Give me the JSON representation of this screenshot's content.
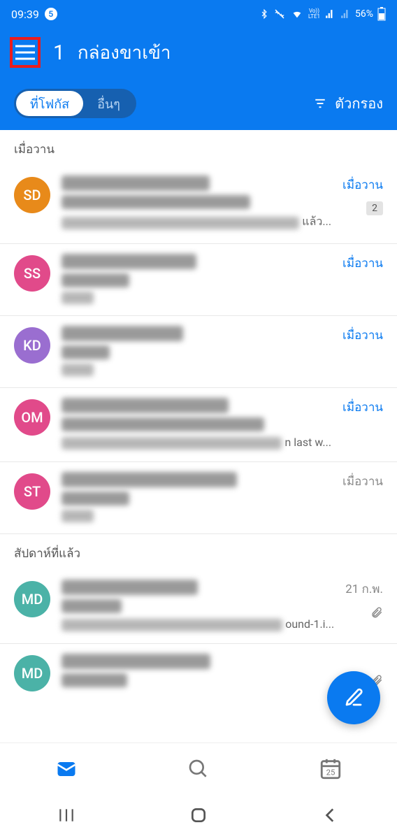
{
  "status": {
    "time": "09:39",
    "notif_count": "5",
    "battery": "56%"
  },
  "header": {
    "highlight_number": "1",
    "title": "กล่องขาเข้า"
  },
  "tabs": {
    "focused": "ที่โฟกัส",
    "other": "อื่นๆ",
    "filter": "ตัวกรอง"
  },
  "sections": {
    "yesterday": "เมื่อวาน",
    "last_week": "สัปดาห์ที่แล้ว"
  },
  "emails": [
    {
      "initials": "SD",
      "color": "c-orange",
      "time": "เมื่อวาน",
      "time_muted": false,
      "count": "2",
      "suffix": "แล้ว...",
      "attach": false
    },
    {
      "initials": "SS",
      "color": "c-pink",
      "time": "เมื่อวาน",
      "time_muted": false,
      "count": "",
      "suffix": "",
      "attach": false
    },
    {
      "initials": "KD",
      "color": "c-purple",
      "time": "เมื่อวาน",
      "time_muted": false,
      "count": "",
      "suffix": "",
      "attach": false
    },
    {
      "initials": "OM",
      "color": "c-pink",
      "time": "เมื่อวาน",
      "time_muted": false,
      "count": "",
      "suffix": "n last w...",
      "attach": false
    },
    {
      "initials": "ST",
      "color": "c-pink",
      "time": "เมื่อวาน",
      "time_muted": true,
      "count": "",
      "suffix": "",
      "attach": false
    },
    {
      "initials": "MD",
      "color": "c-teal",
      "time": "21 ก.พ.",
      "time_muted": true,
      "count": "",
      "suffix": "ound-1.i...",
      "attach": true
    },
    {
      "initials": "MD",
      "color": "c-teal",
      "time": "",
      "time_muted": true,
      "count": "",
      "suffix": "",
      "attach": true
    }
  ],
  "nav": {
    "calendar_day": "25"
  }
}
